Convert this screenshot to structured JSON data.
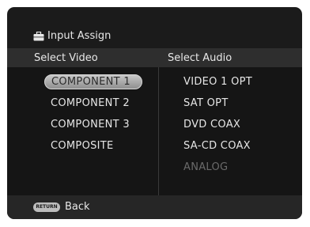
{
  "title": {
    "text": "Input Assign",
    "icon": "suitcase-icon"
  },
  "video": {
    "heading": "Select Video",
    "items": [
      "COMPONENT 1",
      "COMPONENT 2",
      "COMPONENT 3",
      "COMPOSITE"
    ],
    "selected_index": 0
  },
  "audio": {
    "heading": "Select Audio",
    "items": [
      "VIDEO 1 OPT",
      "SAT OPT",
      "DVD COAX",
      "SA-CD COAX",
      "ANALOG"
    ],
    "disabled_index": 4
  },
  "footer": {
    "button_label": "RETURN",
    "back_label": "Back"
  },
  "colors": {
    "background": "#1b1b1b",
    "highlight": "#bdbdbd",
    "disabled": "#6a6a6a"
  }
}
